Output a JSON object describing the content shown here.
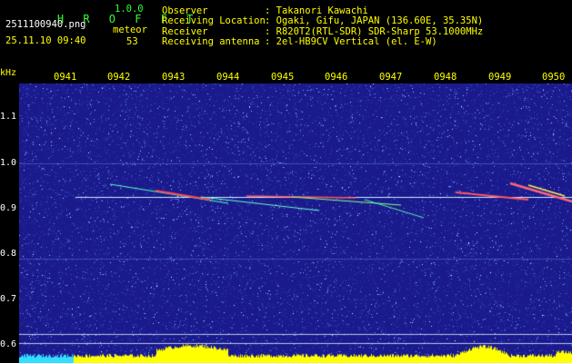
{
  "app": {
    "name": "H R O F F T",
    "version": "1.0.0"
  },
  "file": {
    "name": "2511100940.png",
    "datetime": "25.11.10 09:40"
  },
  "counter": {
    "label": "meteor",
    "value": "53"
  },
  "info": {
    "observer_label": "Observer",
    "observer_value": ": Takanori Kawachi",
    "location_label": "Receiving Location",
    "location_value": ": Ogaki, Gifu, JAPAN (136.60E, 35.35N)",
    "receiver_label": "Receiver",
    "receiver_value": ": R820T2(RTL-SDR) SDR-Sharp 53.1000MHz",
    "antenna_label": "Receiving antenna",
    "antenna_value": ": 2el-HB9CV Vertical (el. E-W)"
  },
  "axis": {
    "unit": "kHz",
    "times": [
      "0941",
      "0942",
      "0943",
      "0944",
      "0945",
      "0946",
      "0947",
      "0948",
      "0949",
      "0950"
    ],
    "freqs": [
      "1.1",
      "1.0",
      "0.9",
      "0.8",
      "0.7",
      "0.6"
    ]
  },
  "colors": {
    "background": "#1a1a8c",
    "signal": "#ffff00",
    "carrier": "#d0f0ff",
    "text_yellow": "#ffff00",
    "text_green": "#33ff33"
  }
}
